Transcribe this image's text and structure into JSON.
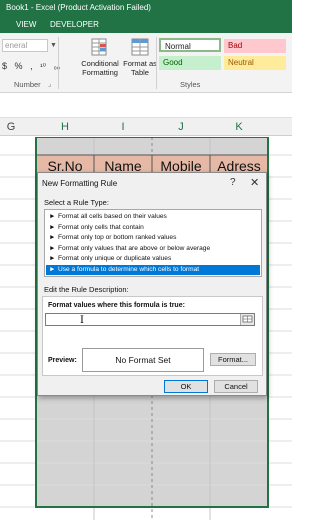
{
  "window": {
    "title": "Book1 - Excel (Product Activation Failed)"
  },
  "ribbon_tabs": {
    "view": "VIEW",
    "developer": "DEVELOPER"
  },
  "number_group": {
    "format_placeholder": "eneral",
    "currency": "$",
    "percent": "%",
    "comma": ",",
    "inc_dec": "¹⁰",
    "dec_dec": "₀₀",
    "label": "Number"
  },
  "styles_group": {
    "conditional_formatting": "Conditional\nFormatting",
    "format_as_table": "Format as\nTable",
    "normal": "Normal",
    "bad": "Bad",
    "good": "Good",
    "neutral": "Neutral",
    "label": "Styles",
    "colors": {
      "bad_bg": "#ffc7ce",
      "bad_fg": "#9c0006",
      "good_bg": "#c6efce",
      "good_fg": "#006100",
      "neutral_bg": "#ffeb9c",
      "neutral_fg": "#9c5700"
    }
  },
  "columns": [
    "G",
    "H",
    "I",
    "J",
    "K"
  ],
  "table_headers": [
    "Sr.No",
    "Name",
    "Mobile",
    "Adress"
  ],
  "dialog": {
    "title": "New Formatting Rule",
    "help": "?",
    "close": "✕",
    "select_rule_type": "Select a Rule Type:",
    "rule_types": [
      "Format all cells based on their values",
      "Format only cells that contain",
      "Format only top or bottom ranked values",
      "Format only values that are above or below average",
      "Format only unique or duplicate values",
      "Use a formula to determine which cells to format"
    ],
    "selected_rule_index": 5,
    "edit_rule_description": "Edit the Rule Description:",
    "formula_label": "Format values where this formula is true:",
    "formula_value": "",
    "preview_label": "Preview:",
    "preview_text": "No Format Set",
    "format_button": "Format...",
    "ok_button": "OK",
    "cancel_button": "Cancel"
  }
}
